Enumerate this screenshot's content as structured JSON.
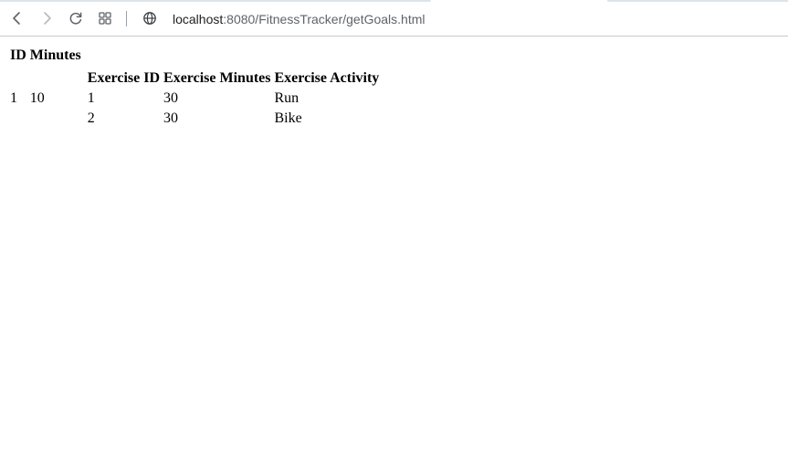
{
  "browser": {
    "url_host": "localhost",
    "url_rest": ":8080/FitnessTracker/getGoals.html",
    "icons": {
      "back": "arrow-left",
      "forward": "arrow-right",
      "reload": "circular-arrow",
      "apps": "four-squares",
      "site_info": "globe"
    }
  },
  "goals": {
    "headers": [
      "ID",
      "Minutes"
    ],
    "rows": [
      {
        "id": "1",
        "minutes": "10",
        "exercises": {
          "headers": [
            "Exercise ID",
            "Exercise Minutes",
            "Exercise Activity"
          ],
          "rows": [
            [
              "1",
              "30",
              "Run"
            ],
            [
              "2",
              "30",
              "Bike"
            ]
          ]
        }
      }
    ]
  },
  "colors": {
    "url_host": "#202124",
    "url_rest": "#5f6368",
    "toolbar_border": "#c8c8c8",
    "icon": "#5f6368"
  }
}
